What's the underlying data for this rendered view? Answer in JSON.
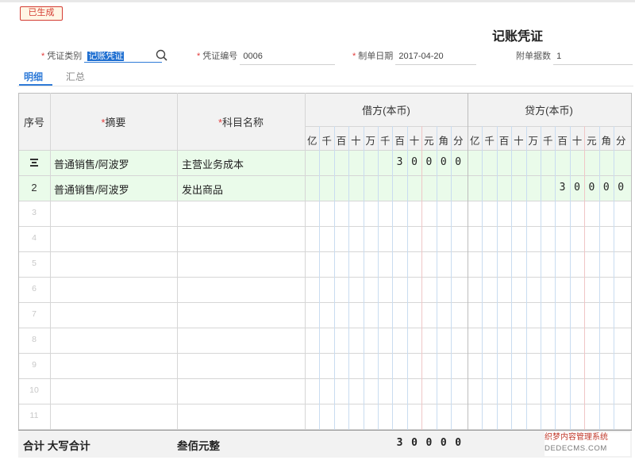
{
  "status_badge": "已生成",
  "title": "记账凭证",
  "fields": {
    "type_label": "凭证类别",
    "type_value": "记账凭证",
    "number_label": "凭证编号",
    "number_value": "0006",
    "date_label": "制单日期",
    "date_value": "2017-04-20",
    "attach_label": "附单据数",
    "attach_value": "1"
  },
  "tabs": [
    "明细",
    "汇总"
  ],
  "table": {
    "headers": {
      "seq": "序号",
      "summary": "摘要",
      "account": "科目名称",
      "debit": "借方(本币)",
      "credit": "贷方(本币)"
    },
    "units": [
      "亿",
      "千",
      "百",
      "十",
      "万",
      "千",
      "百",
      "十",
      "元",
      "角",
      "分"
    ],
    "rows": [
      {
        "seq": "",
        "summary": "普通销售/阿波罗",
        "account": "主营业务成本",
        "debit_digits": [
          "",
          "",
          "",
          "",
          "",
          "",
          "3",
          "0",
          "0",
          "0",
          "0"
        ],
        "credit_digits": [
          "",
          "",
          "",
          "",
          "",
          "",
          "",
          "",
          "",
          "",
          ""
        ]
      },
      {
        "seq": "2",
        "summary": "普通销售/阿波罗",
        "account": "发出商品",
        "debit_digits": [
          "",
          "",
          "",
          "",
          "",
          "",
          "",
          "",
          "",
          "",
          ""
        ],
        "credit_digits": [
          "",
          "",
          "",
          "",
          "",
          "",
          "3",
          "0",
          "0",
          "0",
          "0"
        ]
      },
      {
        "seq": "3"
      },
      {
        "seq": "4"
      },
      {
        "seq": "5"
      },
      {
        "seq": "6"
      },
      {
        "seq": "7"
      },
      {
        "seq": "8"
      },
      {
        "seq": "9"
      },
      {
        "seq": "10"
      },
      {
        "seq": "11"
      }
    ],
    "total": {
      "label": "合计 大写合计",
      "amount_words": "叁佰元整",
      "debit_digits": [
        "",
        "",
        "",
        "",
        "",
        "",
        "3",
        "0",
        "0",
        "0",
        "0"
      ]
    }
  },
  "watermark": {
    "line1": "织梦内容管理系统",
    "line2": "DEDECMS.COM"
  },
  "colors": {
    "accent": "#2f7bd8",
    "required": "#e23b3b",
    "header_bg": "#f2f2f2",
    "active_row_bg": "#eafbea",
    "grid_line": "#d6d6d6",
    "unit_line_blue": "#c9dcf0",
    "unit_line_red": "#f0c6c6"
  }
}
